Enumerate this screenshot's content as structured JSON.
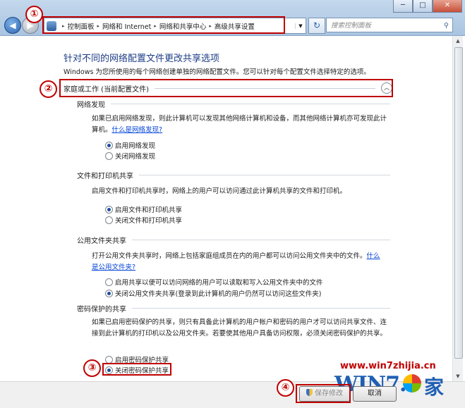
{
  "window": {
    "minimize": "─",
    "maximize": "□",
    "close": "✕"
  },
  "address": {
    "crumbs": [
      "控制面板",
      "网络和 Internet",
      "网络和共享中心",
      "高级共享设置"
    ],
    "separator": "▸"
  },
  "search": {
    "placeholder": "搜索控制面板"
  },
  "page": {
    "title": "针对不同的网络配置文件更改共享选项",
    "desc": "Windows 为您所使用的每个网络创建单独的网络配置文件。您可以针对每个配置文件选择特定的选项。",
    "profile_label": "家庭或工作 (当前配置文件)"
  },
  "sections": {
    "discovery": {
      "heading": "网络发现",
      "text": "如果已启用网络发现，则此计算机可以发现其他网络计算机和设备，而其他网络计算机亦可发现此计算机。",
      "link": "什么是网络发现?",
      "on": "启用网络发现",
      "off": "关闭网络发现"
    },
    "fileprint": {
      "heading": "文件和打印机共享",
      "text": "启用文件和打印机共享时，网络上的用户可以访问通过此计算机共享的文件和打印机。",
      "on": "启用文件和打印机共享",
      "off": "关闭文件和打印机共享"
    },
    "public": {
      "heading": "公用文件夹共享",
      "text": "打开公用文件夹共享时，网络上包括家庭组成员在内的用户都可以访问公用文件夹中的文件。",
      "link1": "什么",
      "link2": "是公用文件夹?",
      "on": "启用共享以便可以访问网络的用户可以读取和写入公用文件夹中的文件",
      "off": "关闭公用文件夹共享(登录到此计算机的用户仍然可以访问这些文件夹)"
    },
    "password": {
      "heading": "密码保护的共享",
      "text": "如果已启用密码保护的共享，则只有具备此计算机的用户帐户和密码的用户才可以访问共享文件、连接到此计算机的打印机以及公用文件夹。若要使其他用户具备访问权限，必须关闭密码保护的共享。",
      "on": "启用密码保护共享",
      "off": "关闭密码保护共享"
    }
  },
  "buttons": {
    "save": "保存修改",
    "cancel": "取消"
  },
  "annotations": [
    "①",
    "②",
    "③",
    "④"
  ],
  "watermark": {
    "url": "www.win7zhijia.cn",
    "logo": "WIN7.",
    "char": "家"
  },
  "colors": {
    "annotation": "#c00000",
    "title": "#1e3d87",
    "link": "#0645d9"
  }
}
